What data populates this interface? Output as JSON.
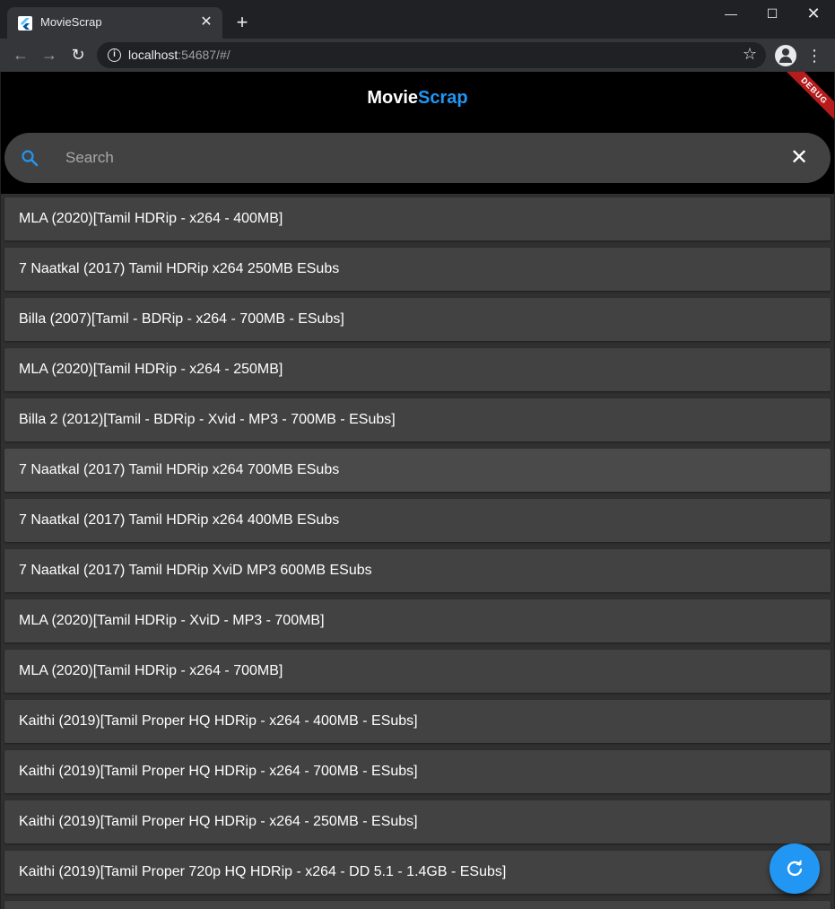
{
  "browser": {
    "tab_title": "MovieScrap",
    "url_host": "localhost",
    "url_path": ":54687/#/"
  },
  "app": {
    "title_part1": "Movie",
    "title_part2": "Scrap",
    "debug_label": "DEBUG",
    "accent_color": "#2196f3"
  },
  "search": {
    "placeholder": "Search"
  },
  "items": [
    "MLA (2020)[Tamil HDRip - x264 - 400MB]",
    "7 Naatkal (2017) Tamil HDRip x264 250MB ESubs",
    "Billa (2007)[Tamil - BDRip - x264 - 700MB - ESubs]",
    "MLA (2020)[Tamil HDRip - x264 - 250MB]",
    "Billa 2 (2012)[Tamil - BDRip - Xvid - MP3 - 700MB - ESubs]",
    "7 Naatkal (2017) Tamil HDRip x264 700MB ESubs",
    "7 Naatkal (2017) Tamil HDRip x264 400MB ESubs",
    "7 Naatkal (2017) Tamil HDRip XviD MP3 600MB ESubs",
    "MLA (2020)[Tamil HDRip - XviD - MP3 - 700MB]",
    "MLA (2020)[Tamil HDRip - x264 - 700MB]",
    "Kaithi (2019)[Tamil Proper HQ HDRip - x264 - 400MB - ESubs]",
    "Kaithi (2019)[Tamil Proper HQ HDRip - x264 - 700MB - ESubs]",
    "Kaithi (2019)[Tamil Proper HQ HDRip - x264 - 250MB - ESubs]",
    "Kaithi (2019)[Tamil Proper 720p HQ HDRip - x264 - DD 5.1 - 1.4GB - ESubs]",
    ""
  ]
}
